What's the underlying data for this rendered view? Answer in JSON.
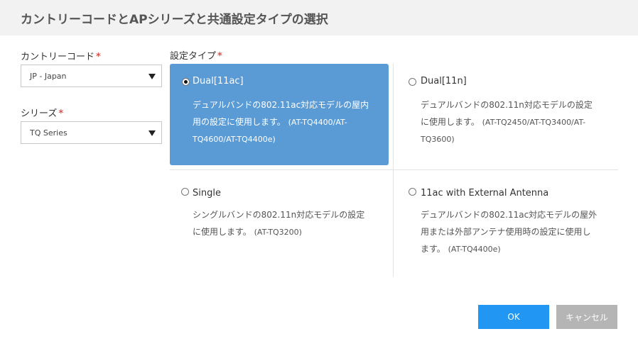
{
  "dialog": {
    "title": "カントリーコードとAPシリーズと共通設定タイプの選択"
  },
  "country": {
    "label": "カントリーコード",
    "required_mark": "*",
    "value": "JP - Japan"
  },
  "series": {
    "label": "シリーズ",
    "required_mark": "*",
    "value": "TQ Series"
  },
  "settings_type": {
    "label": "設定タイプ",
    "required_mark": "*",
    "selected": "Dual[11ac]",
    "options": [
      {
        "title": "Dual[11ac]",
        "desc_line1": "デュアルバンドの802.11ac対応モデルの屋内",
        "desc_line2": "用の設定に使用します。",
        "desc_line2_models": "(AT-TQ4400/AT-",
        "desc_line3": "TQ4600/AT-TQ4400e)"
      },
      {
        "title": "Dual[11n]",
        "desc_line1": "デュアルバンドの802.11n対応モデルの設定",
        "desc_line2": "に使用します。",
        "desc_line2_models": "(AT-TQ2450/AT-TQ3400/AT-",
        "desc_line3": "TQ3600)"
      },
      {
        "title": "Single",
        "desc_line1": "シングルバンドの802.11n対応モデルの設定",
        "desc_line2": "に使用します。",
        "desc_line2_models": "(AT-TQ3200)"
      },
      {
        "title": "11ac with External Antenna",
        "desc_line1": "デュアルバンドの802.11ac対応モデルの屋外",
        "desc_line2": "用または外部アンテナ使用時の設定に使用し",
        "desc_line3": "ます。",
        "desc_line3_models": "(AT-TQ4400e)"
      }
    ]
  },
  "buttons": {
    "ok": "OK",
    "cancel": "キャンセル"
  },
  "colors": {
    "selected_option_bg": "#5a9bd5",
    "ok_button": "#2196f3",
    "cancel_button": "#b5b5b5",
    "required_mark": "#d9534f"
  },
  "icons": {
    "dropdown": "triangle-down-icon"
  }
}
